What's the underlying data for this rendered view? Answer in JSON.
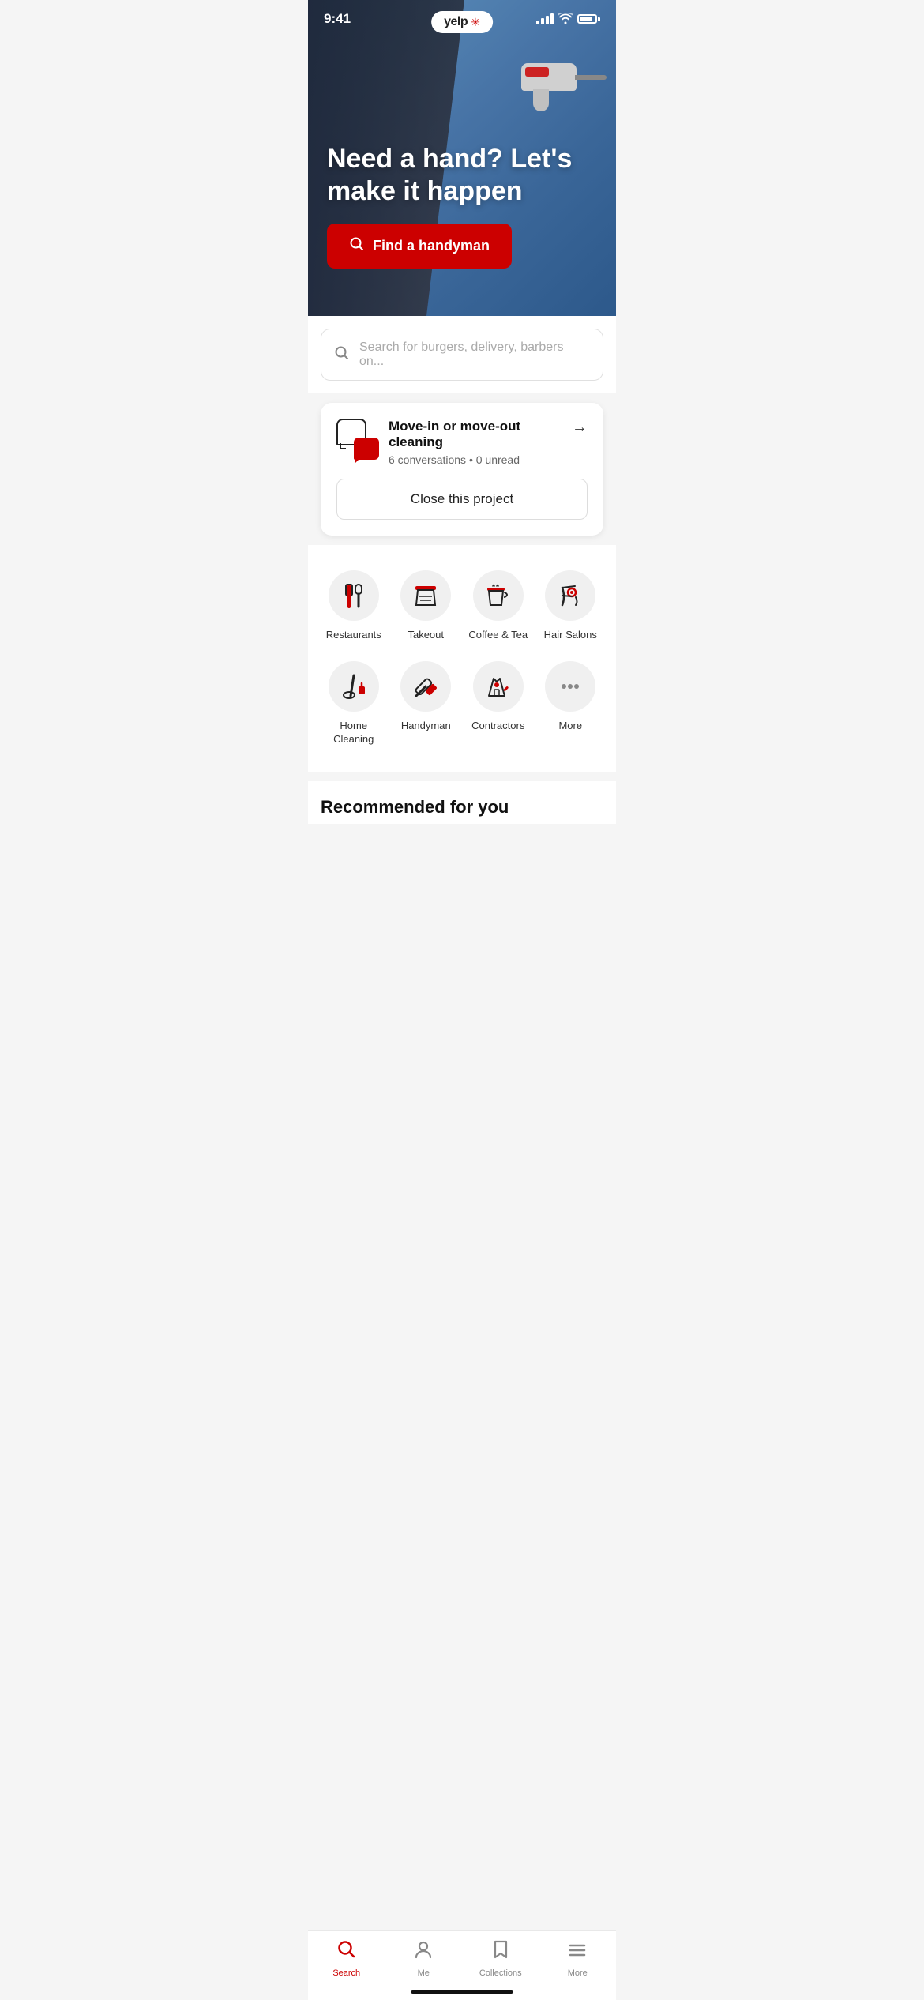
{
  "status_bar": {
    "time": "9:41",
    "signal": 4,
    "wifi": true,
    "battery": 80
  },
  "yelp_logo": {
    "text": "yelp",
    "star": "✳"
  },
  "hero": {
    "title": "Need a hand? Let's make it happen",
    "cta_label": "Find a handyman"
  },
  "search": {
    "placeholder": "Search for burgers, delivery, barbers on..."
  },
  "project_card": {
    "title": "Move-in or move-out cleaning",
    "meta": "6 conversations • 0 unread",
    "close_label": "Close this project",
    "arrow": "→"
  },
  "categories": [
    {
      "id": "restaurants",
      "label": "Restaurants",
      "icon": "restaurant"
    },
    {
      "id": "takeout",
      "label": "Takeout",
      "icon": "takeout"
    },
    {
      "id": "coffee",
      "label": "Coffee & Tea",
      "icon": "coffee"
    },
    {
      "id": "hair-salons",
      "label": "Hair Salons",
      "icon": "hair"
    },
    {
      "id": "home-cleaning",
      "label": "Home Cleaning",
      "icon": "cleaning"
    },
    {
      "id": "handyman",
      "label": "Handyman",
      "icon": "handyman"
    },
    {
      "id": "contractors",
      "label": "Contractors",
      "icon": "contractors"
    },
    {
      "id": "more-categories",
      "label": "More",
      "icon": "more"
    }
  ],
  "recommended": {
    "title": "Recommended for you"
  },
  "bottom_nav": [
    {
      "id": "search",
      "label": "Search",
      "icon": "search",
      "active": true
    },
    {
      "id": "me",
      "label": "Me",
      "icon": "person",
      "active": false
    },
    {
      "id": "collections",
      "label": "Collections",
      "icon": "bookmark",
      "active": false
    },
    {
      "id": "more",
      "label": "More",
      "icon": "menu",
      "active": false
    }
  ]
}
